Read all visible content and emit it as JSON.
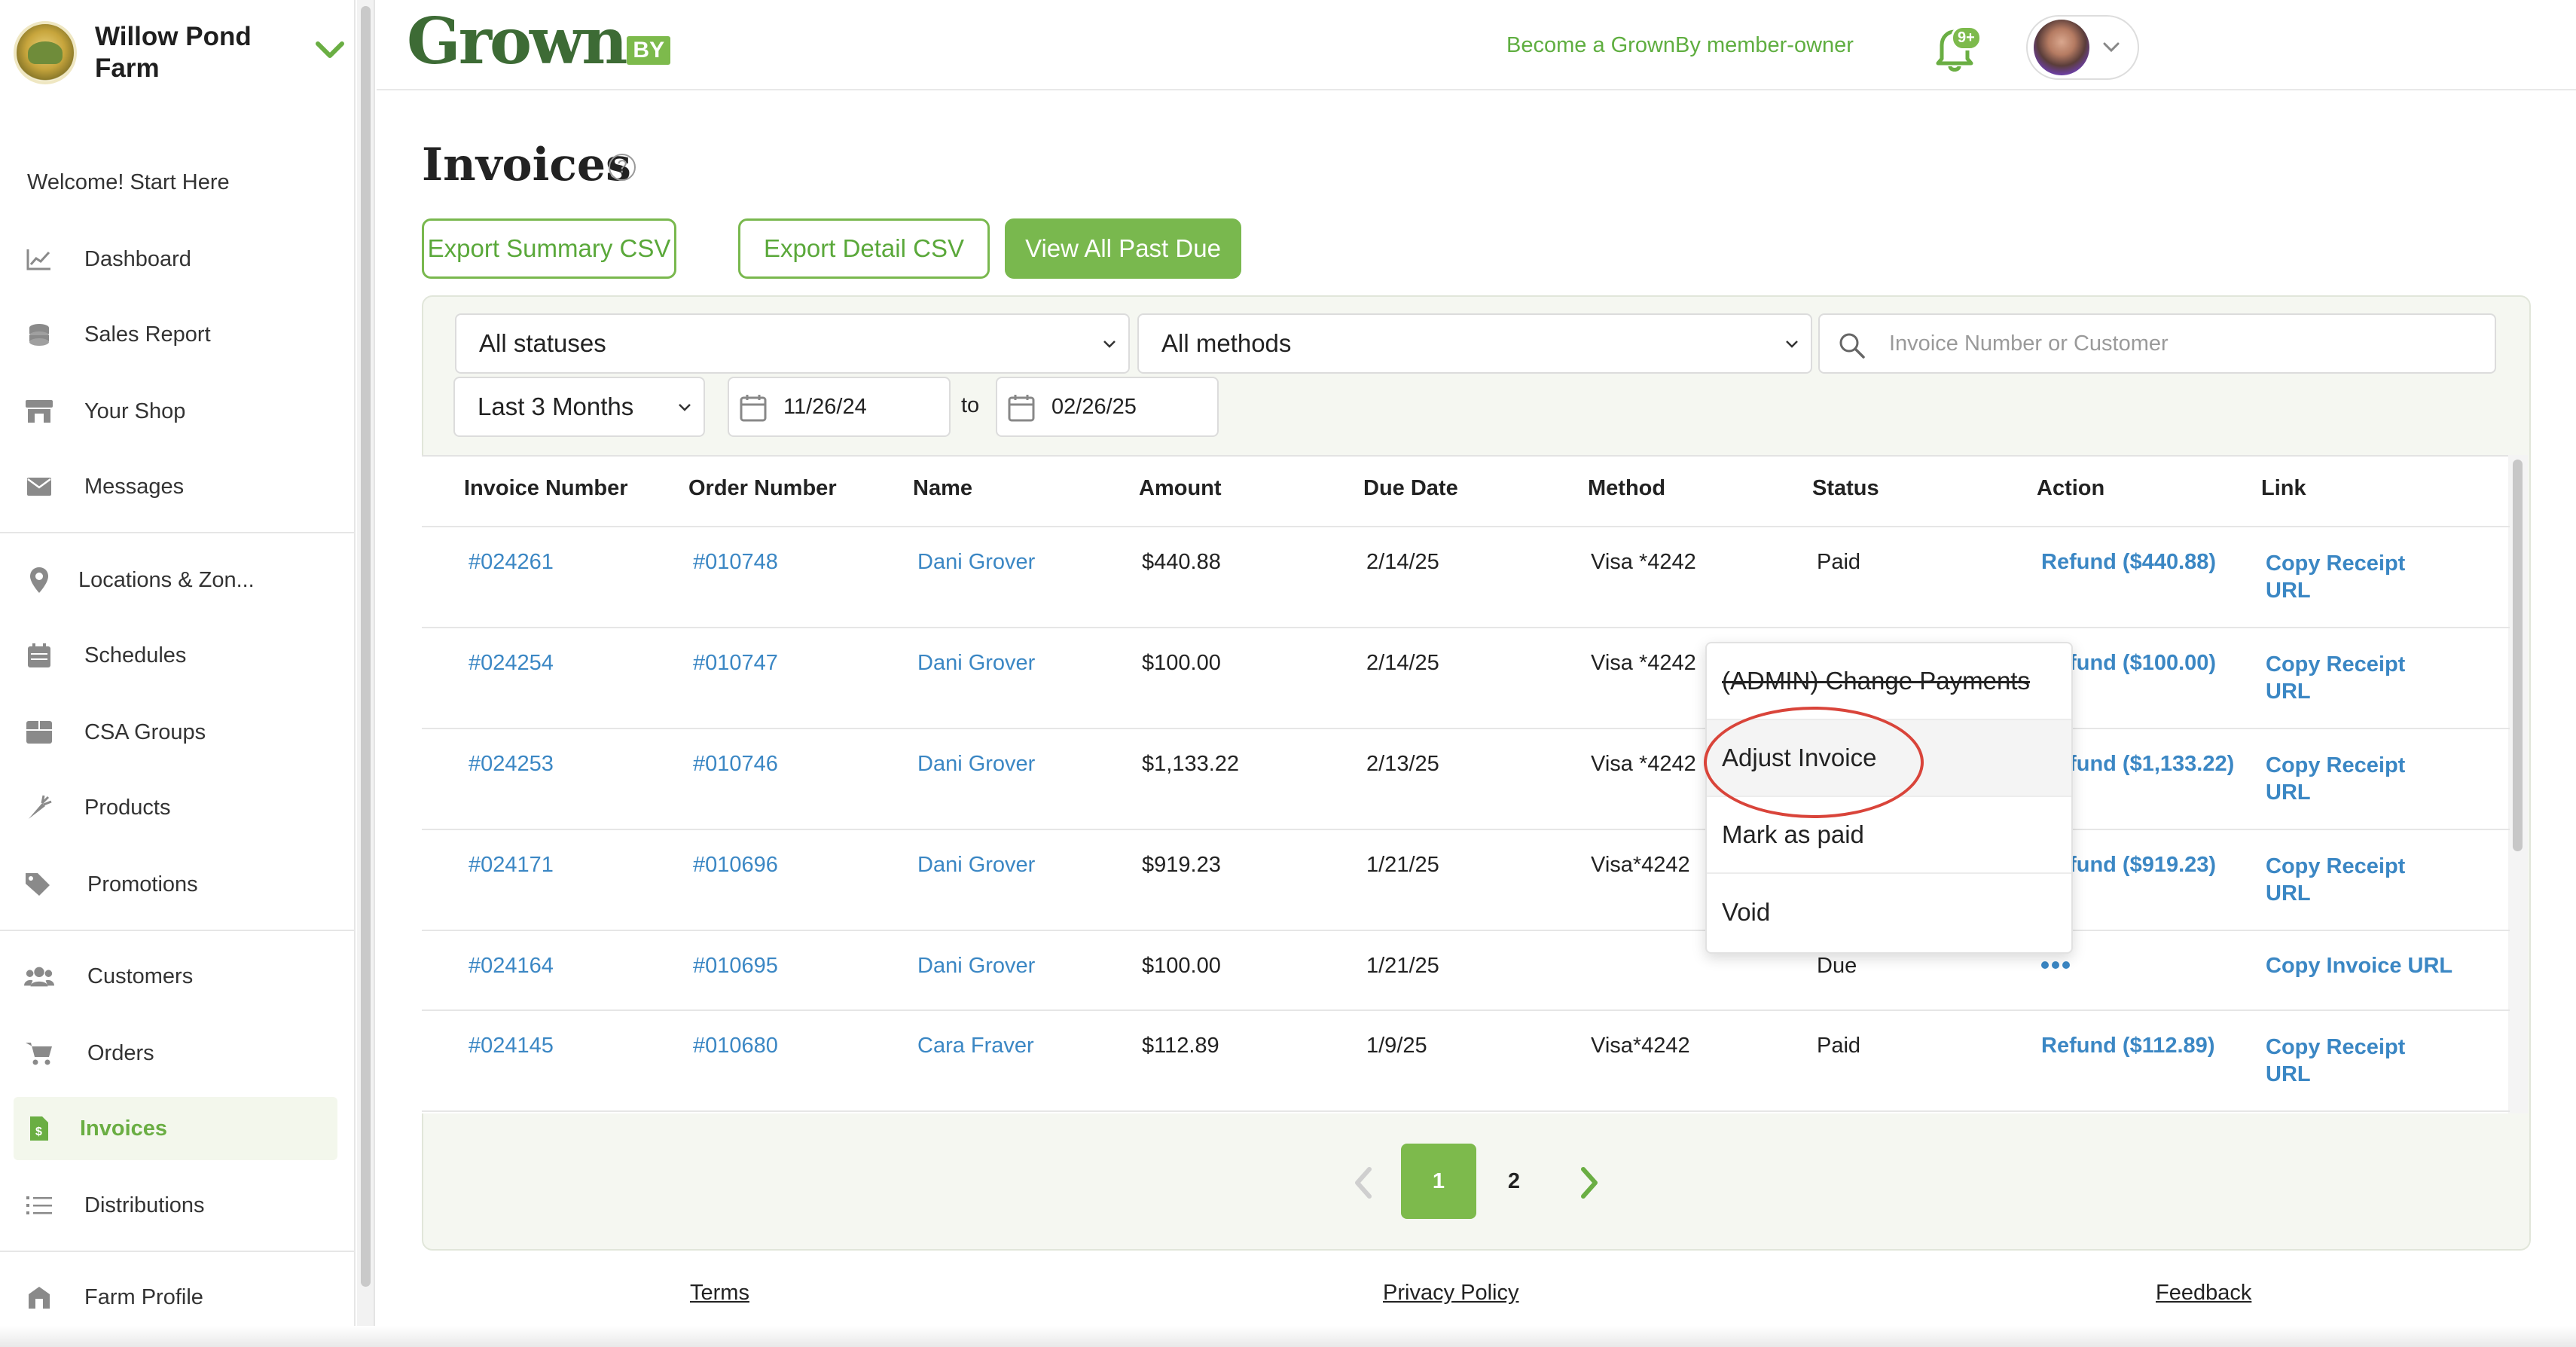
{
  "sidebar": {
    "farm_name": "Willow Pond Farm",
    "welcome": "Welcome! Start Here",
    "items": [
      {
        "label": "Dashboard",
        "icon": "chart-line-icon"
      },
      {
        "label": "Sales Report",
        "icon": "coins-icon"
      },
      {
        "label": "Your Shop",
        "icon": "store-icon"
      },
      {
        "label": "Messages",
        "icon": "envelope-icon"
      },
      {
        "label": "Locations & Zon...",
        "icon": "map-pin-icon"
      },
      {
        "label": "Schedules",
        "icon": "calendar-icon"
      },
      {
        "label": "CSA Groups",
        "icon": "box-icon"
      },
      {
        "label": "Products",
        "icon": "carrot-icon"
      },
      {
        "label": "Promotions",
        "icon": "tags-icon"
      },
      {
        "label": "Customers",
        "icon": "users-icon"
      },
      {
        "label": "Orders",
        "icon": "cart-icon"
      },
      {
        "label": "Invoices",
        "icon": "invoice-icon",
        "active": true
      },
      {
        "label": "Distributions",
        "icon": "list-icon"
      },
      {
        "label": "Farm Profile",
        "icon": "barn-icon"
      }
    ]
  },
  "header": {
    "brand": "Grown",
    "brand_by": "BY",
    "member_link": "Become a GrownBy member-owner",
    "notification_badge": "9+"
  },
  "page": {
    "title": "Invoices",
    "help": "?",
    "buttons": {
      "export_summary": "Export Summary CSV",
      "export_detail": "Export Detail CSV",
      "view_past_due": "View All Past Due"
    }
  },
  "filters": {
    "status": "All statuses",
    "method": "All methods",
    "search_placeholder": "Invoice Number or Customer",
    "range": "Last 3 Months",
    "date_from": "11/26/24",
    "to": "to",
    "date_to": "02/26/25"
  },
  "table": {
    "columns": [
      "Invoice Number",
      "Order Number",
      "Name",
      "Amount",
      "Due Date",
      "Method",
      "Status",
      "Action",
      "Link"
    ],
    "rows": [
      {
        "invoice": "#024261",
        "order": "#010748",
        "name": "Dani Grover",
        "amount": "$440.88",
        "due": "2/14/25",
        "method": "Visa *4242",
        "status": "Paid",
        "action": "Refund ($440.88)",
        "link": "Copy Receipt URL"
      },
      {
        "invoice": "#024254",
        "order": "#010747",
        "name": "Dani Grover",
        "amount": "$100.00",
        "due": "2/14/25",
        "method": "Visa *4242",
        "status": "",
        "action": "Refund ($100.00)",
        "link": "Copy Receipt URL"
      },
      {
        "invoice": "#024253",
        "order": "#010746",
        "name": "Dani Grover",
        "amount": "$1,133.22",
        "due": "2/13/25",
        "method": "Visa *4242",
        "status": "",
        "action": "Refund ($1,133.22)",
        "link": "Copy Receipt URL"
      },
      {
        "invoice": "#024171",
        "order": "#010696",
        "name": "Dani Grover",
        "amount": "$919.23",
        "due": "1/21/25",
        "method": "Visa*4242",
        "status": "",
        "action": "Refund ($919.23)",
        "link": "Copy Receipt URL"
      },
      {
        "invoice": "#024164",
        "order": "#010695",
        "name": "Dani Grover",
        "amount": "$100.00",
        "due": "1/21/25",
        "method": "",
        "status": "Due",
        "action": "",
        "link": "Copy Invoice URL"
      },
      {
        "invoice": "#024145",
        "order": "#010680",
        "name": "Cara Fraver",
        "amount": "$112.89",
        "due": "1/9/25",
        "method": "Visa*4242",
        "status": "Paid",
        "action": "Refund ($112.89)",
        "link": "Copy Receipt URL"
      }
    ]
  },
  "action_menu": {
    "items": [
      "(ADMIN) Change Payments",
      "Adjust Invoice",
      "Mark as paid",
      "Void"
    ]
  },
  "pagination": {
    "pages": [
      "1",
      "2"
    ],
    "current": "1"
  },
  "footer": {
    "terms": "Terms",
    "privacy": "Privacy Policy",
    "feedback": "Feedback"
  },
  "colors": {
    "brand_green": "#7dba4c",
    "dark_green": "#3d6b35",
    "link_blue": "#3b87c4",
    "annotation_red": "#d9443a"
  }
}
